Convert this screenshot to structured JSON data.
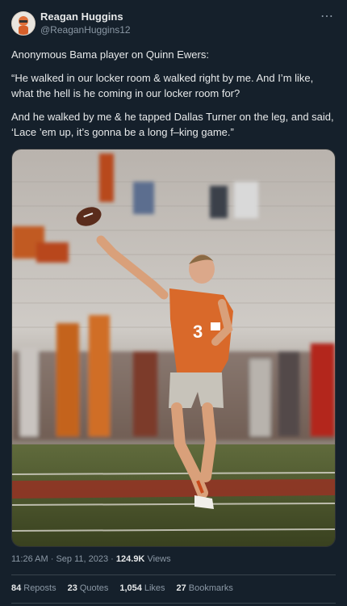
{
  "author": {
    "display_name": "Reagan Huggins",
    "handle": "@ReaganHuggins12",
    "more_icon": "⋯"
  },
  "tweet": {
    "line1": "Anonymous Bama player on Quinn Ewers:",
    "line2": "“He walked in our locker room & walked right by me. And I’m like, what the hell is he coming in our locker room for?",
    "line3": "And he walked by me & he tapped Dallas Turner on the leg, and said, ‘Lace ’em up, it’s gonna be a long f–king game.”"
  },
  "meta": {
    "time": "11:26 AM",
    "sep": "·",
    "date": "Sep 11, 2023",
    "views_count": "124.9K",
    "views_label": "Views"
  },
  "stats": {
    "reposts_count": "84",
    "reposts_label": "Reposts",
    "quotes_count": "23",
    "quotes_label": "Quotes",
    "likes_count": "1,054",
    "likes_label": "Likes",
    "bookmarks_count": "27",
    "bookmarks_label": "Bookmarks"
  },
  "colors": {
    "background": "#15202b",
    "jersey": "#d9692a",
    "field": "#4e5a33",
    "text_secondary": "#8b98a5"
  }
}
